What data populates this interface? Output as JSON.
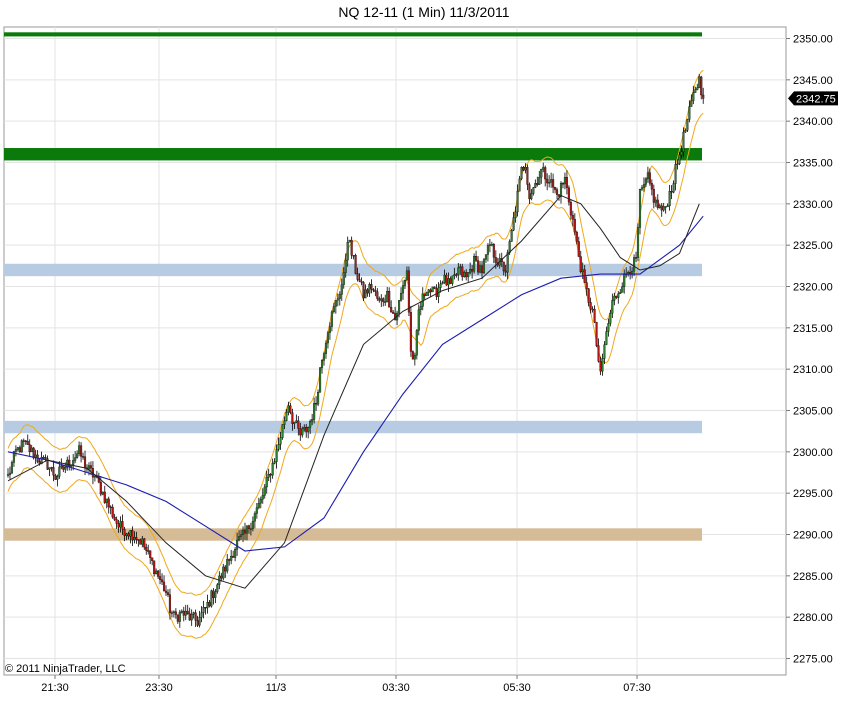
{
  "chart_data": {
    "type": "candlestick",
    "title": "NQ 12-11 (1 Min)  11/3/2011",
    "copyright": "© 2011 NinjaTrader, LLC",
    "last_price_label": "2342.75",
    "last_price": 2342.75,
    "ylim": [
      2272.5,
      2352.5
    ],
    "y_ticks": [
      "2350.00",
      "2345.00",
      "2340.00",
      "2335.00",
      "2330.00",
      "2325.00",
      "2320.00",
      "2315.00",
      "2310.00",
      "2305.00",
      "2300.00",
      "2295.00",
      "2290.00",
      "2285.00",
      "2280.00",
      "2275.00"
    ],
    "x_ticks": [
      "21:30",
      "23:30",
      "11/3",
      "03:30",
      "05:30",
      "07:30"
    ],
    "grid": true,
    "zones": [
      {
        "low": 2350.25,
        "high": 2350.75,
        "color": "#0a7a0a"
      },
      {
        "low": 2335.25,
        "high": 2336.75,
        "color": "#0a7a0a"
      },
      {
        "low": 2321.25,
        "high": 2322.75,
        "color": "#b7cce2"
      },
      {
        "low": 2302.25,
        "high": 2303.75,
        "color": "#b7cce2"
      },
      {
        "low": 2289.25,
        "high": 2290.75,
        "color": "#d6bc96"
      }
    ],
    "price_path": [
      [
        0,
        2297
      ],
      [
        4,
        2300
      ],
      [
        8,
        2301
      ],
      [
        12,
        2300
      ],
      [
        16,
        2299
      ],
      [
        20,
        2298.5
      ],
      [
        24,
        2297
      ],
      [
        28,
        2298
      ],
      [
        32,
        2299
      ],
      [
        36,
        2300
      ],
      [
        40,
        2298
      ],
      [
        44,
        2297
      ],
      [
        48,
        2295
      ],
      [
        52,
        2293
      ],
      [
        56,
        2291
      ],
      [
        60,
        2290.5
      ],
      [
        64,
        2290
      ],
      [
        68,
        2289
      ],
      [
        72,
        2287
      ],
      [
        76,
        2285
      ],
      [
        80,
        2283
      ],
      [
        82,
        2281
      ],
      [
        84,
        2280
      ],
      [
        88,
        2280.5
      ],
      [
        92,
        2280
      ],
      [
        96,
        2279.5
      ],
      [
        100,
        2281
      ],
      [
        104,
        2283
      ],
      [
        108,
        2285
      ],
      [
        112,
        2287
      ],
      [
        116,
        2289
      ],
      [
        120,
        2290
      ],
      [
        124,
        2292
      ],
      [
        128,
        2294
      ],
      [
        132,
        2297
      ],
      [
        136,
        2300
      ],
      [
        140,
        2304
      ],
      [
        142,
        2306
      ],
      [
        144,
        2304
      ],
      [
        148,
        2302
      ],
      [
        152,
        2303
      ],
      [
        156,
        2306
      ],
      [
        158,
        2310
      ],
      [
        162,
        2315
      ],
      [
        166,
        2318
      ],
      [
        170,
        2321
      ],
      [
        172,
        2326
      ],
      [
        176,
        2322
      ],
      [
        180,
        2319
      ],
      [
        184,
        2320
      ],
      [
        188,
        2318
      ],
      [
        192,
        2319
      ],
      [
        196,
        2316
      ],
      [
        200,
        2320
      ],
      [
        202,
        2322
      ],
      [
        204,
        2312
      ],
      [
        206,
        2311
      ],
      [
        208,
        2317
      ],
      [
        212,
        2320
      ],
      [
        216,
        2319
      ],
      [
        220,
        2321
      ],
      [
        224,
        2320
      ],
      [
        228,
        2322
      ],
      [
        232,
        2321
      ],
      [
        236,
        2323
      ],
      [
        240,
        2322
      ],
      [
        244,
        2325
      ],
      [
        248,
        2323
      ],
      [
        252,
        2322
      ],
      [
        256,
        2328
      ],
      [
        260,
        2334
      ],
      [
        262,
        2335
      ],
      [
        264,
        2331
      ],
      [
        266,
        2332
      ],
      [
        270,
        2334
      ],
      [
        274,
        2333
      ],
      [
        278,
        2331
      ],
      [
        282,
        2333
      ],
      [
        286,
        2328
      ],
      [
        288,
        2325
      ],
      [
        292,
        2320
      ],
      [
        296,
        2317
      ],
      [
        298,
        2313
      ],
      [
        300,
        2309
      ],
      [
        302,
        2313
      ],
      [
        306,
        2318
      ],
      [
        310,
        2320
      ],
      [
        314,
        2322
      ],
      [
        318,
        2323
      ],
      [
        320,
        2331
      ],
      [
        324,
        2333
      ],
      [
        328,
        2330
      ],
      [
        332,
        2329
      ],
      [
        336,
        2332
      ],
      [
        340,
        2336
      ],
      [
        344,
        2340
      ],
      [
        348,
        2344
      ],
      [
        350,
        2345
      ],
      [
        352,
        2342.75
      ]
    ],
    "series": [
      {
        "name": "",
        "color": "#1c1cb0",
        "width": 1.1,
        "values": [
          [
            0,
            2300
          ],
          [
            20,
            2299
          ],
          [
            40,
            2297.5
          ],
          [
            60,
            2296
          ],
          [
            80,
            2294
          ],
          [
            100,
            2291
          ],
          [
            120,
            2288
          ],
          [
            140,
            2288.5
          ],
          [
            160,
            2292
          ],
          [
            180,
            2300
          ],
          [
            200,
            2307
          ],
          [
            220,
            2313
          ],
          [
            240,
            2316
          ],
          [
            260,
            2319
          ],
          [
            280,
            2321
          ],
          [
            300,
            2321.5
          ],
          [
            320,
            2321.5
          ],
          [
            340,
            2325
          ],
          [
            352,
            2328.5
          ]
        ]
      },
      {
        "name": "",
        "color": "#222222",
        "width": 1,
        "values": [
          [
            0,
            2296.5
          ],
          [
            20,
            2299
          ],
          [
            40,
            2298
          ],
          [
            60,
            2294
          ],
          [
            80,
            2289
          ],
          [
            100,
            2285
          ],
          [
            120,
            2283.5
          ],
          [
            140,
            2289
          ],
          [
            160,
            2302
          ],
          [
            180,
            2313
          ],
          [
            200,
            2317
          ],
          [
            220,
            2319.5
          ],
          [
            240,
            2321
          ],
          [
            260,
            2325.5
          ],
          [
            280,
            2331
          ],
          [
            290,
            2330
          ],
          [
            300,
            2327
          ],
          [
            310,
            2323.5
          ],
          [
            320,
            2322
          ],
          [
            330,
            2322.5
          ],
          [
            340,
            2324
          ],
          [
            350,
            2330
          ]
        ]
      }
    ]
  }
}
